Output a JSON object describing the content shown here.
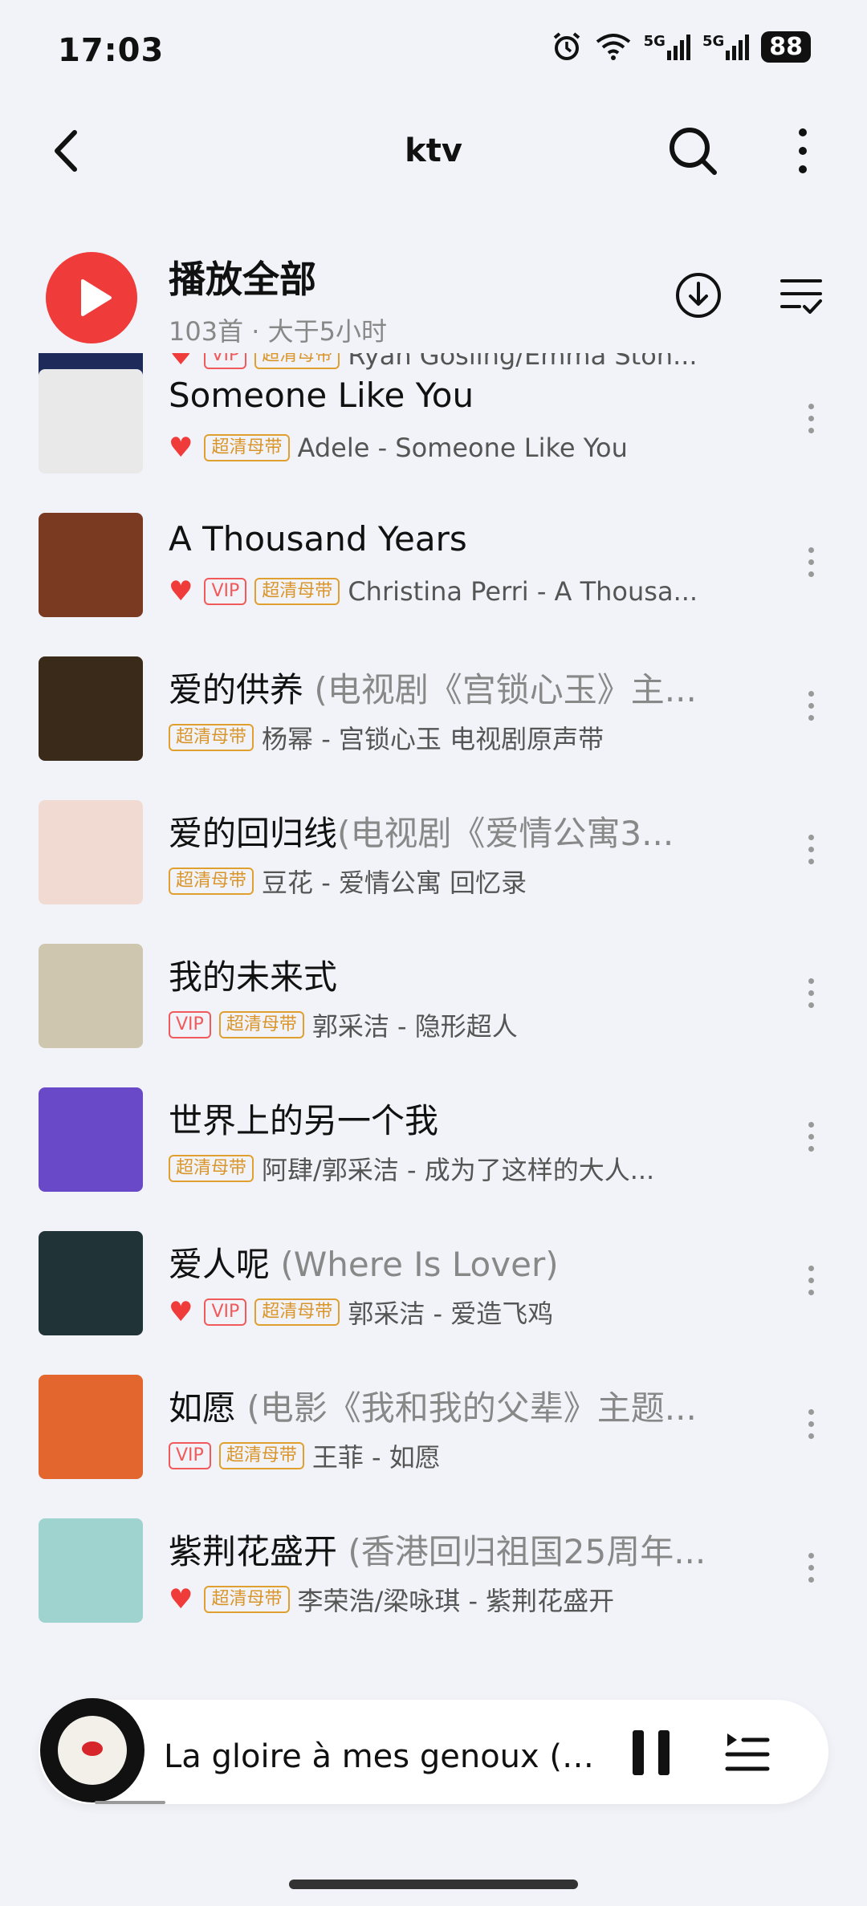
{
  "status": {
    "time": "17:03",
    "battery": "88",
    "network1": "5G",
    "network2": "5G"
  },
  "nav": {
    "title": "ktv"
  },
  "header": {
    "play_all": "播放全部",
    "meta": "103首 · 大于5小时"
  },
  "list": [
    {
      "title": "",
      "subtitle": "",
      "liked": true,
      "vip": true,
      "hq": true,
      "artist": "Ryan Gosling/Emma Ston...",
      "cover": "#1d2a5a"
    },
    {
      "title": "Someone Like You",
      "subtitle": "",
      "liked": true,
      "vip": false,
      "hq": true,
      "artist": "Adele - Someone Like You",
      "cover": "#e9e9e9"
    },
    {
      "title": "A Thousand Years",
      "subtitle": "",
      "liked": true,
      "vip": true,
      "hq": true,
      "artist": "Christina Perri - A Thousa...",
      "cover": "#7a3a22"
    },
    {
      "title": "爱的供养",
      "subtitle": " (电视剧《宫锁心玉》主...",
      "liked": false,
      "vip": false,
      "hq": true,
      "artist": "杨幂 - 宫锁心玉 电视剧原声带",
      "cover": "#3a2a1a"
    },
    {
      "title": "爱的回归线",
      "subtitle": "(电视剧《爱情公寓3...",
      "liked": false,
      "vip": false,
      "hq": true,
      "artist": "豆花 - 爱情公寓 回忆录",
      "cover": "#f1dad2"
    },
    {
      "title": "我的未来式",
      "subtitle": "",
      "liked": false,
      "vip": true,
      "hq": true,
      "artist": "郭采洁 - 隐形超人",
      "cover": "#cfc6b0"
    },
    {
      "title": "世界上的另一个我",
      "subtitle": "",
      "liked": false,
      "vip": false,
      "hq": true,
      "artist": "阿肆/郭采洁 - 成为了这样的大人...",
      "cover": "#6a49c8"
    },
    {
      "title": "爱人呢",
      "subtitle": " (Where Is Lover)",
      "liked": true,
      "vip": true,
      "hq": true,
      "artist": "郭采洁 - 爱造飞鸡",
      "cover": "#203438"
    },
    {
      "title": "如愿",
      "subtitle": " (电影《我和我的父辈》主题...",
      "liked": false,
      "vip": true,
      "hq": true,
      "artist": "王菲 - 如愿",
      "cover": "#e2662e"
    },
    {
      "title": "紫荆花盛开",
      "subtitle": " (香港回归祖国25周年...",
      "liked": true,
      "vip": false,
      "hq": true,
      "artist": "李荣浩/梁咏琪 - 紫荆花盛开",
      "cover": "#9fd3cf"
    }
  ],
  "tags": {
    "vip": "VIP",
    "hq": "超清母带"
  },
  "player": {
    "title": "La gloire à mes genoux (荣..."
  }
}
